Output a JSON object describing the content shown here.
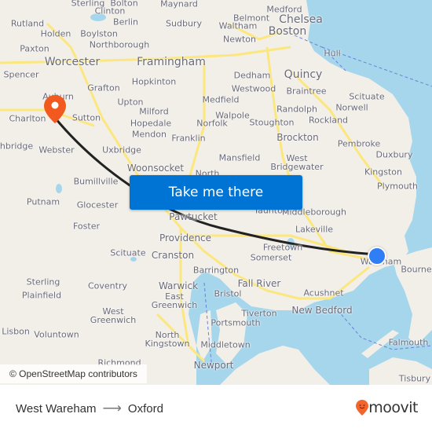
{
  "map": {
    "cta_label": "Take me there",
    "attribution": "© OpenStreetMap contributors",
    "colors": {
      "land": "#f2efe9",
      "water": "#a5d6ec",
      "road": "#fbe77e",
      "route": "#222222",
      "origin": "#2f7ef5",
      "destination": "#f2591e",
      "cta": "#0074d4"
    },
    "places": [
      {
        "name": "Sterling",
        "size": "s"
      },
      {
        "name": "Bolton",
        "size": "s"
      },
      {
        "name": "Maynard",
        "size": "s"
      },
      {
        "name": "Clinton",
        "size": "s"
      },
      {
        "name": "Rutland",
        "size": "s"
      },
      {
        "name": "Berlin",
        "size": "s"
      },
      {
        "name": "Sudbury",
        "size": "s"
      },
      {
        "name": "Holden",
        "size": "s"
      },
      {
        "name": "Boylston",
        "size": "s"
      },
      {
        "name": "Paxton",
        "size": "s"
      },
      {
        "name": "Northborough",
        "size": "s"
      },
      {
        "name": "Worcester",
        "size": "l"
      },
      {
        "name": "Framingham",
        "size": "l"
      },
      {
        "name": "Spencer",
        "size": "s"
      },
      {
        "name": "Hopkinton",
        "size": "s"
      },
      {
        "name": "Grafton",
        "size": "s"
      },
      {
        "name": "Auburn",
        "size": "s"
      },
      {
        "name": "Upton",
        "size": "s"
      },
      {
        "name": "Milford",
        "size": "s"
      },
      {
        "name": "Charlton",
        "size": "s"
      },
      {
        "name": "Sutton",
        "size": "s"
      },
      {
        "name": "Hopedale",
        "size": "s"
      },
      {
        "name": "Mendon",
        "size": "s"
      },
      {
        "name": "Franklin",
        "size": "s"
      },
      {
        "name": "Webster",
        "size": "s"
      },
      {
        "name": "Uxbridge",
        "size": "s"
      },
      {
        "name": "Woonsocket",
        "size": "m"
      },
      {
        "name": "Bumillville",
        "size": "s"
      },
      {
        "name": "Medford",
        "size": "s"
      },
      {
        "name": "Belmont",
        "size": "s"
      },
      {
        "name": "Chelsea",
        "size": "l"
      },
      {
        "name": "Waltham",
        "size": "s"
      },
      {
        "name": "Boston",
        "size": "l"
      },
      {
        "name": "Newton",
        "size": "s"
      },
      {
        "name": "Hull",
        "size": "s"
      },
      {
        "name": "Dedham",
        "size": "s"
      },
      {
        "name": "Quincy",
        "size": "l"
      },
      {
        "name": "Westwood",
        "size": "s"
      },
      {
        "name": "Braintree",
        "size": "s"
      },
      {
        "name": "Medfield",
        "size": "s"
      },
      {
        "name": "Scituate",
        "size": "s"
      },
      {
        "name": "Randolph",
        "size": "s"
      },
      {
        "name": "Norwell",
        "size": "s"
      },
      {
        "name": "Walpole",
        "size": "s"
      },
      {
        "name": "Norfolk",
        "size": "s"
      },
      {
        "name": "Stoughton",
        "size": "s"
      },
      {
        "name": "Rockland",
        "size": "s"
      },
      {
        "name": "Brockton",
        "size": "m"
      },
      {
        "name": "Pembroke",
        "size": "s"
      },
      {
        "name": "Mansfield",
        "size": "s"
      },
      {
        "name": "West Bridgewater",
        "size": "s"
      },
      {
        "name": "Duxbury",
        "size": "s"
      },
      {
        "name": "Kingston",
        "size": "s"
      },
      {
        "name": "Plymouth",
        "size": "s"
      },
      {
        "name": "North",
        "size": "s"
      },
      {
        "name": "Putnam",
        "size": "s"
      },
      {
        "name": "Glocester",
        "size": "s"
      },
      {
        "name": "Pawtucket",
        "size": "m"
      },
      {
        "name": "Taunton",
        "size": "s"
      },
      {
        "name": "Middleborough",
        "size": "s"
      },
      {
        "name": "Foster",
        "size": "s"
      },
      {
        "name": "Lakeville",
        "size": "s"
      },
      {
        "name": "Providence",
        "size": "m"
      },
      {
        "name": "Scituate",
        "size": "s"
      },
      {
        "name": "Cranston",
        "size": "m"
      },
      {
        "name": "Freetown",
        "size": "s"
      },
      {
        "name": "Somerset",
        "size": "s"
      },
      {
        "name": "Wareham",
        "size": "s"
      },
      {
        "name": "Bourne",
        "size": "s"
      },
      {
        "name": "Barrington",
        "size": "s"
      },
      {
        "name": "Sterling",
        "size": "s"
      },
      {
        "name": "Coventry",
        "size": "s"
      },
      {
        "name": "Warwick",
        "size": "m"
      },
      {
        "name": "Fall River",
        "size": "m"
      },
      {
        "name": "Plainfield",
        "size": "s"
      },
      {
        "name": "East Greenwich",
        "size": "s"
      },
      {
        "name": "Bristol",
        "size": "s"
      },
      {
        "name": "Acushnet",
        "size": "s"
      },
      {
        "name": "West Greenwich",
        "size": "s"
      },
      {
        "name": "Tiverton",
        "size": "s"
      },
      {
        "name": "New Bedford",
        "size": "m"
      },
      {
        "name": "Portsmouth",
        "size": "s"
      },
      {
        "name": "Lisbon",
        "size": "s"
      },
      {
        "name": "Voluntown",
        "size": "s"
      },
      {
        "name": "North Kingstown",
        "size": "s"
      },
      {
        "name": "Middletown",
        "size": "s"
      },
      {
        "name": "Falmouth",
        "size": "s"
      },
      {
        "name": "Richmond",
        "size": "s"
      },
      {
        "name": "Newport",
        "size": "m"
      },
      {
        "name": "Tisbury",
        "size": "s"
      },
      {
        "name": "chbridge",
        "size": "s"
      }
    ]
  },
  "footer": {
    "origin": "West Wareham",
    "arrow": "⟶",
    "destination": "Oxford",
    "logo_text": "moovit"
  }
}
